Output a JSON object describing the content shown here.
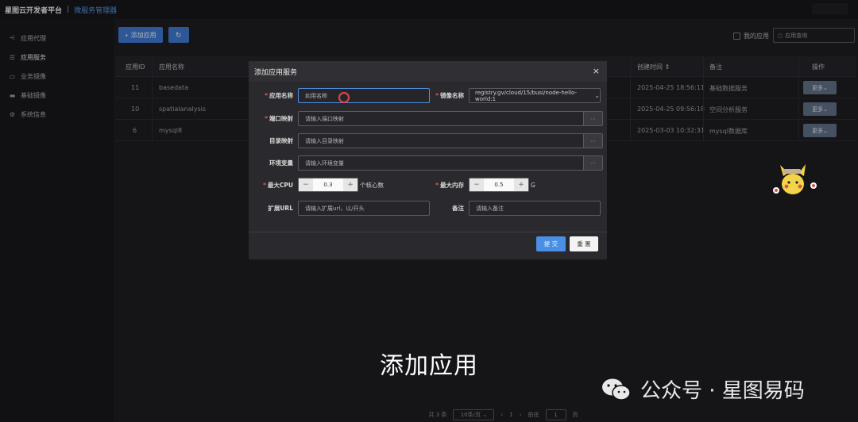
{
  "topbar": {
    "brand": "星图云开发者平台",
    "separator": "|",
    "subtitle": "微服务管理器"
  },
  "sidebar": {
    "items": [
      {
        "label": "应用代理",
        "icon": "share-icon",
        "glyph": "⩤"
      },
      {
        "label": "应用服务",
        "icon": "sliders-icon",
        "glyph": "☰"
      },
      {
        "label": "业务镜像",
        "icon": "image-icon",
        "glyph": "▭"
      },
      {
        "label": "基础镜像",
        "icon": "monitor-icon",
        "glyph": "▬"
      },
      {
        "label": "系统信息",
        "icon": "gear-icon",
        "glyph": "⚙"
      }
    ]
  },
  "toolbar": {
    "add_label": "添加应用",
    "add_glyph": "+",
    "refresh_glyph": "↻",
    "mine_label": "我的应用",
    "search_placeholder": "应用查询"
  },
  "table": {
    "headers": {
      "id": "应用ID",
      "name": "应用名称",
      "created": "创建时间 ⇕",
      "remark": "备注",
      "action": "操作"
    },
    "rows": [
      {
        "id": "11",
        "name": "basedata",
        "created": "2025-04-25 18:56:11",
        "remark": "基础数据服务",
        "more": "更多⌄"
      },
      {
        "id": "10",
        "name": "spatialanalysis",
        "created": "2025-04-25 09:56:18",
        "remark": "空间分析服务",
        "more": "更多⌄"
      },
      {
        "id": "6",
        "name": "mysql8",
        "created": "2025-03-03 10:32:31",
        "remark": "mysql数据库",
        "more": "更多⌄"
      }
    ]
  },
  "pager": {
    "total": "共 3 条",
    "size": "10条/页 ⌄",
    "prev": "‹",
    "current": "1",
    "next": "›",
    "goto": "前往",
    "page_value": "1",
    "page_unit": "页"
  },
  "modal": {
    "title": "添加应用服务",
    "close": "×",
    "app_name": {
      "label": "应用名称",
      "value": "如用名称"
    },
    "image_name": {
      "label": "镜像名称",
      "value": "registry.gv/cloud/15/busi/node-hello-world:1",
      "chevron": "⌄"
    },
    "port": {
      "label": "端口映射",
      "placeholder": "请输入端口映射",
      "drop": "⋯"
    },
    "dir": {
      "label": "目录映射",
      "placeholder": "请输入目录映射",
      "drop": "⋯"
    },
    "env": {
      "label": "环境变量",
      "placeholder": "请输入环境变量",
      "drop": "⋯"
    },
    "cpu": {
      "label": "最大CPU",
      "minus": "−",
      "value": "0.3",
      "plus": "+",
      "unit": "个核心数"
    },
    "mem": {
      "label": "最大内存",
      "minus": "−",
      "value": "0.5",
      "plus": "+",
      "unit": "G"
    },
    "url": {
      "label": "扩展URL",
      "placeholder": "请输入扩展url，以/开头"
    },
    "remark": {
      "label": "备注",
      "placeholder": "请输入备注"
    },
    "required_mark": "*",
    "submit": "提 交",
    "reset": "重 置"
  },
  "caption": "添加应用",
  "watermark": {
    "text": "公众号 · 星图易码",
    "icon": "wechat-icon"
  },
  "colors": {
    "accent": "#3c74c8",
    "link": "#4f8fe0",
    "required": "#e05555"
  }
}
